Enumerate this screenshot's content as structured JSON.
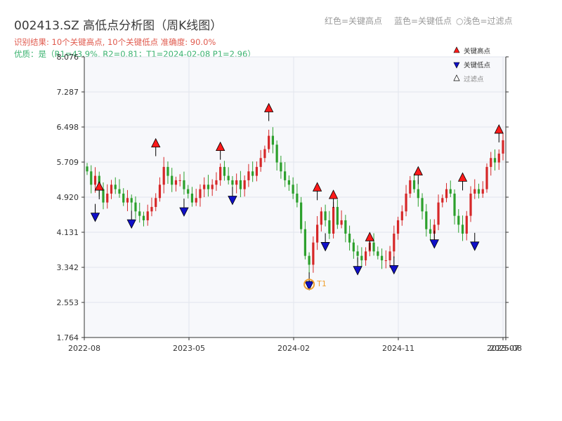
{
  "header": {
    "title": "002413.SZ 高低点分析图（周K线图）",
    "result_line": "识别结果: 10个关键高点, 10个关键低点   准确度: 90.0%",
    "quality_line": "优质：是（R1=43.9%, R2=0.81；T1=2024-02-08 P1=2.96）",
    "legend_top": [
      "红色=关键高点",
      "蓝色=关键低点",
      "○浅色=过滤点"
    ]
  },
  "colors": {
    "up": "#d62728",
    "down": "#2ca02c",
    "high_marker": "#ff1a1a",
    "low_marker": "#1010c8",
    "t1_ring": "#f0a030",
    "plot_bg": "#f7f8fb"
  },
  "chart_data": {
    "type": "candlestick",
    "title": "002413.SZ 高低点分析图（周K线图）",
    "x_ticks": [
      "2022-08",
      "2023-05",
      "2024-02",
      "2024-11",
      "2025-07",
      "2025-08"
    ],
    "y_ticks": [
      "1.764",
      "2.553",
      "3.342",
      "4.131",
      "4.920",
      "5.709",
      "6.498",
      "7.287",
      "8.076"
    ],
    "ylim": [
      1.764,
      8.076
    ],
    "xlim": [
      "2022-08",
      "2025-08"
    ],
    "legend": [
      {
        "label": "关键高点",
        "marker": "triangle-up"
      },
      {
        "label": "关键低点",
        "marker": "triangle-down"
      },
      {
        "label": "过滤点",
        "marker": "triangle-outline"
      }
    ],
    "legend_position": "top-right",
    "grid": true,
    "closes": [
      5.5,
      5.2,
      5.4,
      5.1,
      4.8,
      5.0,
      5.2,
      5.1,
      5.0,
      4.8,
      4.9,
      4.8,
      4.6,
      4.5,
      4.4,
      4.6,
      4.7,
      4.9,
      5.2,
      5.6,
      5.4,
      5.2,
      5.3,
      5.3,
      5.1,
      5.0,
      4.8,
      4.9,
      5.1,
      5.2,
      5.1,
      5.2,
      5.3,
      5.6,
      5.4,
      5.3,
      5.2,
      5.3,
      5.1,
      5.3,
      5.5,
      5.4,
      5.6,
      5.8,
      6.0,
      6.3,
      6.1,
      5.7,
      5.5,
      5.3,
      5.2,
      5.0,
      4.8,
      4.2,
      3.6,
      3.4,
      3.9,
      4.3,
      4.6,
      4.4,
      4.1,
      4.7,
      4.3,
      4.4,
      4.1,
      3.9,
      3.7,
      3.6,
      3.5,
      3.7,
      3.9,
      3.7,
      3.6,
      3.5,
      3.5,
      3.7,
      4.1,
      4.4,
      4.6,
      5.0,
      5.3,
      5.1,
      4.9,
      4.6,
      4.2,
      4.1,
      4.3,
      4.8,
      4.9,
      5.1,
      5.0,
      4.5,
      4.3,
      4.1,
      4.5,
      5.0,
      5.1,
      5.0,
      5.1,
      5.6,
      5.8,
      5.7,
      5.9,
      6.2
    ],
    "key_highs": [
      {
        "index": 3,
        "value": 5.14
      },
      {
        "index": 17,
        "value": 6.11
      },
      {
        "index": 33,
        "value": 6.03
      },
      {
        "index": 45,
        "value": 6.9
      },
      {
        "index": 57,
        "value": 5.12
      },
      {
        "index": 61,
        "value": 4.95
      },
      {
        "index": 70,
        "value": 4.0
      },
      {
        "index": 82,
        "value": 5.48
      },
      {
        "index": 93,
        "value": 5.34
      },
      {
        "index": 102,
        "value": 6.42
      }
    ],
    "key_lows": [
      {
        "index": 2,
        "value": 4.5
      },
      {
        "index": 11,
        "value": 4.35
      },
      {
        "index": 24,
        "value": 4.62
      },
      {
        "index": 36,
        "value": 4.88
      },
      {
        "index": 55,
        "value": 2.96
      },
      {
        "index": 59,
        "value": 3.84
      },
      {
        "index": 67,
        "value": 3.3
      },
      {
        "index": 76,
        "value": 3.32
      },
      {
        "index": 86,
        "value": 3.9
      },
      {
        "index": 96,
        "value": 3.85
      }
    ],
    "annotation": {
      "label": "T1",
      "index": 55,
      "value": 2.96
    }
  }
}
